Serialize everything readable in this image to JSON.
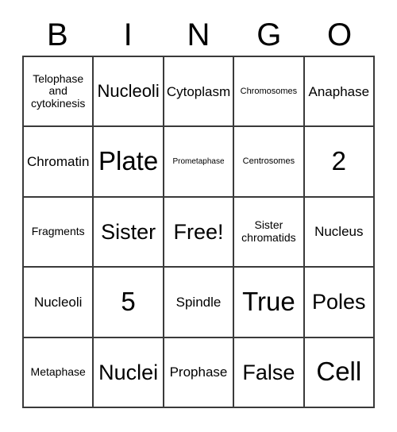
{
  "card": {
    "title": "BINGO Card",
    "free_space_label": "Free!",
    "columns": 5,
    "rows": 5,
    "border_color": "#3a3a3a",
    "background_color": "#ffffff",
    "text_color": "#000000"
  },
  "header": {
    "letters": [
      {
        "label": "B"
      },
      {
        "label": "I"
      },
      {
        "label": "N"
      },
      {
        "label": "G"
      },
      {
        "label": "O"
      }
    ]
  },
  "grid": {
    "rows": [
      {
        "cells": [
          {
            "label": "Telophase and cytokinesis",
            "size": "sm",
            "free": false
          },
          {
            "label": "Nucleoli",
            "size": "lg",
            "free": false
          },
          {
            "label": "Cytoplasm",
            "size": "md",
            "free": false
          },
          {
            "label": "Chromosomes",
            "size": "xs",
            "free": false
          },
          {
            "label": "Anaphase",
            "size": "md",
            "free": false
          }
        ]
      },
      {
        "cells": [
          {
            "label": "Chromatin",
            "size": "md",
            "free": false
          },
          {
            "label": "Plate",
            "size": "xxl",
            "free": false
          },
          {
            "label": "Prometaphase",
            "size": "xxs",
            "free": false
          },
          {
            "label": "Centrosomes",
            "size": "xs",
            "free": false
          },
          {
            "label": "2",
            "size": "xxl",
            "free": false
          }
        ]
      },
      {
        "cells": [
          {
            "label": "Fragments",
            "size": "sm",
            "free": false
          },
          {
            "label": "Sister",
            "size": "xl",
            "free": false
          },
          {
            "label": "Free!",
            "size": "xl",
            "free": true
          },
          {
            "label": "Sister chromatids",
            "size": "sm",
            "free": false
          },
          {
            "label": "Nucleus",
            "size": "md",
            "free": false
          }
        ]
      },
      {
        "cells": [
          {
            "label": "Nucleoli",
            "size": "md",
            "free": false
          },
          {
            "label": "5",
            "size": "xxl",
            "free": false
          },
          {
            "label": "Spindle",
            "size": "md",
            "free": false
          },
          {
            "label": "True",
            "size": "xxl",
            "free": false
          },
          {
            "label": "Poles",
            "size": "xl",
            "free": false
          }
        ]
      },
      {
        "cells": [
          {
            "label": "Metaphase",
            "size": "sm",
            "free": false
          },
          {
            "label": "Nuclei",
            "size": "xl",
            "free": false
          },
          {
            "label": "Prophase",
            "size": "md",
            "free": false
          },
          {
            "label": "False",
            "size": "xl",
            "free": false
          },
          {
            "label": "Cell",
            "size": "xxl",
            "free": false
          }
        ]
      }
    ]
  }
}
